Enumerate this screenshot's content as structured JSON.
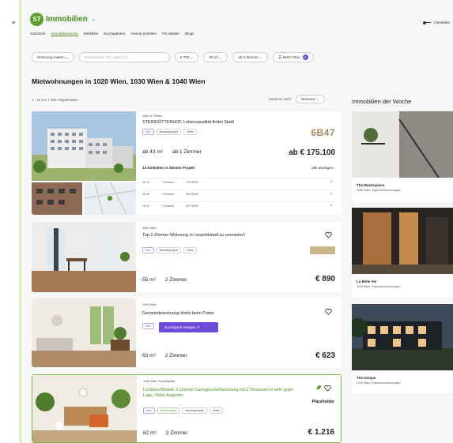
{
  "header": {
    "logo_mark": "ST",
    "logo_text": "Immobilien",
    "nav": [
      "Startseite",
      "Immobiliensuche",
      "Merkliste",
      "Suchagenten",
      "Inserat erstellen",
      "Für Makler",
      "Blogs"
    ],
    "login": "Anmelden"
  },
  "filters": {
    "type": "Wohnung mieten",
    "search_placeholder": "Bundesland, Ort, oder PLZ",
    "price": "€ 750",
    "area": "60 m²",
    "rooms": "ab 2 Zimmer",
    "more": "Mehr Filter",
    "more_count": "2"
  },
  "main": {
    "title": "Mietwohnungen in 1020 Wien, 1030 Wien & 1040 Wien",
    "results": "1 - 15 von 7.000+ Ergebnissen",
    "sort_label": "Sortieren nach:",
    "sort_value": "Relevanz"
  },
  "listings": [
    {
      "location": "1030 St. Pölten",
      "title": "STEINGÖTTERHOF, Lebensqualität findet Stadt",
      "tags": [
        "Neu",
        "Neubauprojekt",
        "Video"
      ],
      "area": "ab 43 m²",
      "rooms": "ab 1 Zimmer",
      "price": "ab € 175.100",
      "brand": "6B47",
      "units_label": "13 Einheiten in diesem Projekt",
      "units_link": "alle anzeigen",
      "units": [
        {
          "area": "43 m²",
          "rooms": "2 Zimmer",
          "price": "175.100€"
        },
        {
          "area": "46 m²",
          "rooms": "3 Zimmer",
          "price": "282.500€"
        },
        {
          "area": "78 m²",
          "rooms": "2 Zimmer",
          "price": "297.000€"
        }
      ]
    },
    {
      "location": "1020 Wien",
      "title": "Top 2-Zimmer-Wohnung in Leopoldstadt zu vermieten!",
      "tags": [
        "Neu",
        "Neubauprojekt",
        "Video"
      ],
      "area": "55 m²",
      "rooms": "2 Zimmer",
      "price": "€ 890"
    },
    {
      "location": "1020 Wien",
      "title": "Gemeindewohnung direkt beim Prater",
      "tags": [
        "Neu"
      ],
      "save_search": "Suchagent anlegen",
      "area": "63 m²",
      "rooms": "2 Zimmer",
      "price": "€ 623"
    },
    {
      "location": "1030 Wien, Rudolfsplatz",
      "title": "Lichtdurchflutete 3 Zimmer Dachgeschoßwohnung mit 2 Terrassen in sehr guter Lage, Nähe Augarten",
      "tags": [
        "Neu",
        "Green Home",
        "Neubauprojekt",
        "Video"
      ],
      "brand": "Placeholder",
      "area": "82 m²",
      "rooms": "2 Zimmer",
      "price": "€ 1.216"
    }
  ],
  "sidebar": {
    "title": "Immobilien der Woche",
    "items": [
      {
        "name": "The Masterpiece",
        "sub": "1080 Wien, Eigentumswohnungen"
      },
      {
        "name": "La Belle Vie",
        "sub": "1190 Wien, Eigentumswohnungen"
      },
      {
        "name": "The Unique",
        "sub": "1190 Wien, Eigentumswohnungen"
      }
    ]
  },
  "colors": {
    "brand_green": "#5aa02c",
    "accent_purple": "#6b4bd8"
  }
}
